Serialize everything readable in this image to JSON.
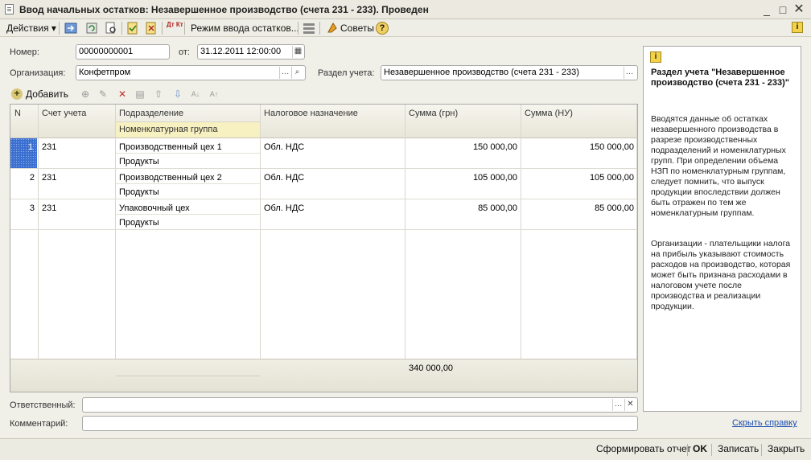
{
  "window": {
    "title": "Ввод начальных остатков: Незавершенное производство (счета 231 - 233). Проведен"
  },
  "toolbar": {
    "actions": "Действия",
    "mode": "Режим ввода остатков...",
    "tips": "Советы",
    "help_q": "?",
    "dt_kt": "Дт Кт"
  },
  "form": {
    "number_label": "Номер:",
    "number": "00000000001",
    "date_label": "от:",
    "date": "31.12.2011 12:00:00",
    "org_label": "Организация:",
    "org": "Конфетпром",
    "section_label": "Раздел учета:",
    "section": "Незавершенное производство (счета 231 - 233)",
    "responsible_label": "Ответственный:",
    "responsible": "",
    "comment_label": "Комментарий:",
    "comment": "",
    "hide_help": "Скрыть справку"
  },
  "table_toolbar": {
    "add": "Добавить"
  },
  "table": {
    "headers": {
      "n": "N",
      "account": "Счет учета",
      "division": "Подразделение",
      "nomgroup": "Номенклатурная группа",
      "tax": "Налоговое назначение",
      "sum": "Сумма (грн)",
      "sum_nu": "Сумма (НУ)"
    },
    "rows": [
      {
        "n": "1",
        "account": "231",
        "division": "Производственный цех 1",
        "nomgroup": "Продукты",
        "tax": "Обл. НДС",
        "sum": "150 000,00",
        "sum_nu": "150 000,00"
      },
      {
        "n": "2",
        "account": "231",
        "division": "Производственный цех 2",
        "nomgroup": "Продукты",
        "tax": "Обл. НДС",
        "sum": "105 000,00",
        "sum_nu": "105 000,00"
      },
      {
        "n": "3",
        "account": "231",
        "division": "Упаковочный цех",
        "nomgroup": "Продукты",
        "tax": "Обл. НДС",
        "sum": "85 000,00",
        "sum_nu": "85 000,00"
      }
    ],
    "total_sum": "340 000,00"
  },
  "help": {
    "title": "Раздел учета \"Незавершенное производство (счета 231 - 233)\"",
    "p1": "Вводятся данные об остатках незавершенного производства в разрезе производственных подразделений и номенклатурных групп. При определении объема НЗП по номенклатурным группам, следует помнить, что выпуск продукции впоследствии должен быть отражен по тем же номенклатурным группам.",
    "p2": "Организации - плательщики налога на прибыль указывают стоимость расходов на производство, которая может быть признана расходами в налоговом учете после производства и реализации продукции."
  },
  "status": {
    "report": "Сформировать отчет",
    "ok": "OK",
    "write": "Записать",
    "close": "Закрыть"
  }
}
